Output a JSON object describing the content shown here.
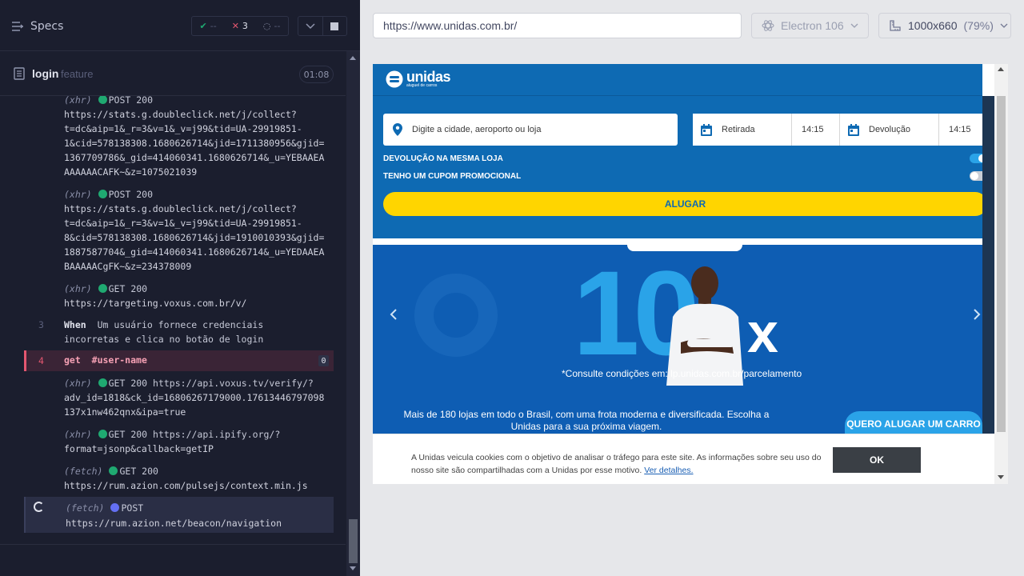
{
  "runner": {
    "specs_label": "Specs",
    "stats": {
      "passed": "--",
      "failed": "3",
      "pending": "--"
    },
    "spec": {
      "name": "login",
      "ext": "feature",
      "duration": "01:08"
    }
  },
  "log": {
    "e1": {
      "tag": "(xhr)",
      "method": "POST 200",
      "lines": [
        "https://stats.g.doubleclick.net/j/collect?",
        "t=dc&aip=1&_r=3&v=1&_v=j99&tid=UA-29919851-",
        "1&cid=578138308.1680626714&jid=1711380956&gjid=",
        "1367709786&_gid=414060341.1680626714&_u=YEBAAEA",
        "AAAAAACAFK~&z=1075021039"
      ]
    },
    "e2": {
      "tag": "(xhr)",
      "method": "POST 200",
      "lines": [
        "https://stats.g.doubleclick.net/j/collect?",
        "t=dc&aip=1&_r=3&v=1&_v=j99&tid=UA-29919851-",
        "8&cid=578138308.1680626714&jid=1910010393&gjid=",
        "1887587704&_gid=414060341.1680626714&_u=YEDAAEA",
        "BAAAAACgFK~&z=234378009"
      ]
    },
    "e3": {
      "tag": "(xhr)",
      "method": "GET 200",
      "lines": [
        "https://targeting.voxus.com.br/v/"
      ]
    },
    "step3": {
      "num": "3",
      "keyword": "When",
      "lines": [
        "Um usuário fornece credenciais",
        "incorretas e clica no botão de login"
      ]
    },
    "step4": {
      "num": "4",
      "cmd": "get",
      "selector": "#user-name",
      "badge": "0"
    },
    "e5": {
      "tag": "(xhr)",
      "method": "GET 200",
      "first": "https://api.voxus.tv/verify/?",
      "lines": [
        "adv_id=1818&ck_id=16806267179000.17613446797098",
        "137x1nw462qnx&ipa=true"
      ]
    },
    "e6": {
      "tag": "(xhr)",
      "method": "GET 200",
      "first": "https://api.ipify.org/?",
      "lines": [
        "format=jsonp&callback=getIP"
      ]
    },
    "e7": {
      "tag": "(fetch)",
      "method": "GET 200",
      "lines": [
        "https://rum.azion.com/pulsejs/context.min.js"
      ]
    },
    "e8": {
      "tag": "(fetch)",
      "method": "POST",
      "lines": [
        "https://rum.azion.net/beacon/navigation"
      ]
    }
  },
  "aut_header": {
    "url": "https://www.unidas.com.br/",
    "browser": "Electron 106",
    "viewport": "1000x660",
    "zoom": "(79%)"
  },
  "site": {
    "logo_word": "unidas",
    "logo_sub": "aluguel de carros",
    "city_placeholder": "Digite a cidade, aeroporto ou loja",
    "pickup_label": "Retirada",
    "pickup_time": "14:15",
    "return_label": "Devolução",
    "return_time": "14:15",
    "toggle_same_store": "DEVOLUÇÃO NA MESMA LOJA",
    "toggle_coupon": "TENHO UM CUPOM PROMOCIONAL",
    "rent_button": "ALUGAR",
    "banner_big": "10",
    "banner_x": "x",
    "banner_note": "*Consulte condições em: lp.unidas.com.br/parcelamento",
    "info_text": "Mais de 180 lojas em todo o Brasil, com uma frota moderna e diversificada. Escolha a Unidas para a sua próxima viagem.",
    "info_button": "QUERO ALUGAR UM CARRO",
    "cookie_text": "A Unidas veicula cookies com o objetivo de analisar o tráfego para este site. As informações sobre seu uso do nosso site são compartilhadas com a Unidas por esse motivo.",
    "cookie_link": "Ver detalhes.",
    "cookie_ok": "OK"
  },
  "colors": {
    "brand_blue": "#0e6ab3",
    "accent_yellow": "#ffd500",
    "fail_red": "#e45770",
    "pass_green": "#1fa971"
  },
  "toggles": {
    "same_store": true,
    "coupon": false
  }
}
